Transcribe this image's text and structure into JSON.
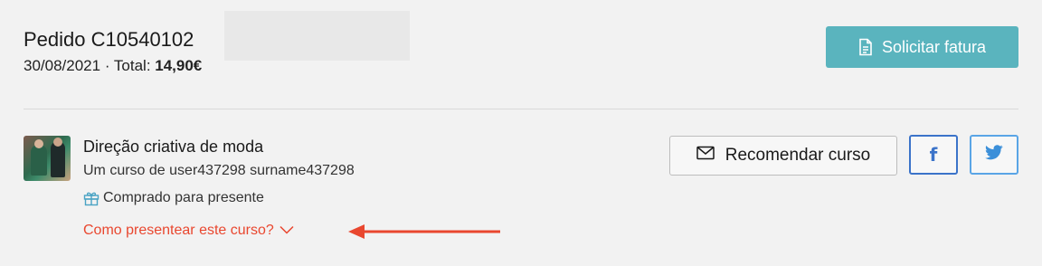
{
  "order": {
    "title": "Pedido C10540102",
    "date": "30/08/2021",
    "separator": " · ",
    "total_label": "Total: ",
    "total_value": "14,90€"
  },
  "invoice_button": {
    "label": "Solicitar fatura",
    "icon": "document-icon"
  },
  "course": {
    "title": "Direção criativa de moda",
    "author": "Um curso de user437298 surname437298",
    "gift_status": "Comprado para presente",
    "gift_icon": "gift-icon",
    "how_to_gift": "Como presentear este curso?"
  },
  "recommend_button": {
    "label": "Recomendar curso",
    "icon": "envelope-icon"
  },
  "social": {
    "facebook_icon": "facebook-icon",
    "twitter_icon": "twitter-icon"
  },
  "colors": {
    "background": "#f2f2f2",
    "invoice_button": "#5ab4be",
    "link_red": "#e9472f",
    "facebook_border": "#3b73c9",
    "twitter_border": "#5aa5e6"
  }
}
